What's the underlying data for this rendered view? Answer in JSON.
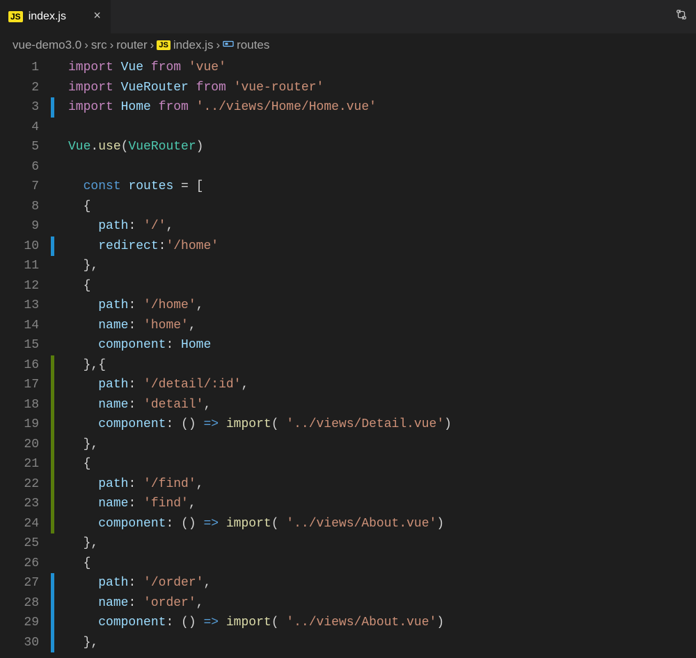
{
  "tab": {
    "filename": "index.js"
  },
  "breadcrumbs": {
    "parts": [
      "vue-demo3.0",
      "src",
      "router"
    ],
    "file": "index.js",
    "symbol": "routes"
  },
  "line_count": 30,
  "markers": [
    "none",
    "none",
    "mod",
    "none",
    "none",
    "none",
    "none",
    "none",
    "none",
    "mod",
    "none",
    "none",
    "none",
    "none",
    "none",
    "add",
    "add",
    "add",
    "add",
    "add",
    "add",
    "add",
    "add",
    "add",
    "none",
    "none",
    "mod",
    "mod",
    "mod",
    "mod"
  ],
  "code": [
    [
      [
        "kw",
        "import"
      ],
      [
        "punc",
        " "
      ],
      [
        "var",
        "Vue"
      ],
      [
        "punc",
        " "
      ],
      [
        "kw",
        "from"
      ],
      [
        "punc",
        " "
      ],
      [
        "str",
        "'vue'"
      ]
    ],
    [
      [
        "kw",
        "import"
      ],
      [
        "punc",
        " "
      ],
      [
        "var",
        "VueRouter"
      ],
      [
        "punc",
        " "
      ],
      [
        "kw",
        "from"
      ],
      [
        "punc",
        " "
      ],
      [
        "str",
        "'vue-router'"
      ]
    ],
    [
      [
        "kw",
        "import"
      ],
      [
        "punc",
        " "
      ],
      [
        "var",
        "Home"
      ],
      [
        "punc",
        " "
      ],
      [
        "kw",
        "from"
      ],
      [
        "punc",
        " "
      ],
      [
        "str",
        "'../views/Home/Home.vue'"
      ]
    ],
    [],
    [
      [
        "type",
        "Vue"
      ],
      [
        "punc",
        "."
      ],
      [
        "fn",
        "use"
      ],
      [
        "punc",
        "("
      ],
      [
        "type",
        "VueRouter"
      ],
      [
        "punc",
        ")"
      ]
    ],
    [],
    [
      [
        "punc",
        "  "
      ],
      [
        "const",
        "const"
      ],
      [
        "punc",
        " "
      ],
      [
        "var",
        "routes"
      ],
      [
        "punc",
        " = ["
      ]
    ],
    [
      [
        "punc",
        "  {"
      ]
    ],
    [
      [
        "punc",
        "    "
      ],
      [
        "var",
        "path"
      ],
      [
        "punc",
        ": "
      ],
      [
        "str",
        "'/'"
      ],
      [
        "punc",
        ","
      ]
    ],
    [
      [
        "punc",
        "    "
      ],
      [
        "var",
        "redirect"
      ],
      [
        "punc",
        ":"
      ],
      [
        "str",
        "'/home'"
      ]
    ],
    [
      [
        "punc",
        "  },"
      ]
    ],
    [
      [
        "punc",
        "  {"
      ]
    ],
    [
      [
        "punc",
        "    "
      ],
      [
        "var",
        "path"
      ],
      [
        "punc",
        ": "
      ],
      [
        "str",
        "'/home'"
      ],
      [
        "punc",
        ","
      ]
    ],
    [
      [
        "punc",
        "    "
      ],
      [
        "var",
        "name"
      ],
      [
        "punc",
        ": "
      ],
      [
        "str",
        "'home'"
      ],
      [
        "punc",
        ","
      ]
    ],
    [
      [
        "punc",
        "    "
      ],
      [
        "var",
        "component"
      ],
      [
        "punc",
        ": "
      ],
      [
        "var",
        "Home"
      ]
    ],
    [
      [
        "punc",
        "  },{"
      ]
    ],
    [
      [
        "punc",
        "    "
      ],
      [
        "var",
        "path"
      ],
      [
        "punc",
        ": "
      ],
      [
        "str",
        "'/detail/:id'"
      ],
      [
        "punc",
        ","
      ]
    ],
    [
      [
        "punc",
        "    "
      ],
      [
        "var",
        "name"
      ],
      [
        "punc",
        ": "
      ],
      [
        "str",
        "'detail'"
      ],
      [
        "punc",
        ","
      ]
    ],
    [
      [
        "punc",
        "    "
      ],
      [
        "var",
        "component"
      ],
      [
        "punc",
        ": () "
      ],
      [
        "const",
        "=>"
      ],
      [
        "punc",
        " "
      ],
      [
        "fn",
        "import"
      ],
      [
        "punc",
        "( "
      ],
      [
        "str",
        "'../views/Detail.vue'"
      ],
      [
        "punc",
        ")"
      ]
    ],
    [
      [
        "punc",
        "  },"
      ]
    ],
    [
      [
        "punc",
        "  {"
      ]
    ],
    [
      [
        "punc",
        "    "
      ],
      [
        "var",
        "path"
      ],
      [
        "punc",
        ": "
      ],
      [
        "str",
        "'/find'"
      ],
      [
        "punc",
        ","
      ]
    ],
    [
      [
        "punc",
        "    "
      ],
      [
        "var",
        "name"
      ],
      [
        "punc",
        ": "
      ],
      [
        "str",
        "'find'"
      ],
      [
        "punc",
        ","
      ]
    ],
    [
      [
        "punc",
        "    "
      ],
      [
        "var",
        "component"
      ],
      [
        "punc",
        ": () "
      ],
      [
        "const",
        "=>"
      ],
      [
        "punc",
        " "
      ],
      [
        "fn",
        "import"
      ],
      [
        "punc",
        "( "
      ],
      [
        "str",
        "'../views/About.vue'"
      ],
      [
        "punc",
        ")"
      ]
    ],
    [
      [
        "punc",
        "  },"
      ]
    ],
    [
      [
        "punc",
        "  {"
      ]
    ],
    [
      [
        "punc",
        "    "
      ],
      [
        "var",
        "path"
      ],
      [
        "punc",
        ": "
      ],
      [
        "str",
        "'/order'"
      ],
      [
        "punc",
        ","
      ]
    ],
    [
      [
        "punc",
        "    "
      ],
      [
        "var",
        "name"
      ],
      [
        "punc",
        ": "
      ],
      [
        "str",
        "'order'"
      ],
      [
        "punc",
        ","
      ]
    ],
    [
      [
        "punc",
        "    "
      ],
      [
        "var",
        "component"
      ],
      [
        "punc",
        ": () "
      ],
      [
        "const",
        "=>"
      ],
      [
        "punc",
        " "
      ],
      [
        "fn",
        "import"
      ],
      [
        "punc",
        "( "
      ],
      [
        "str",
        "'../views/About.vue'"
      ],
      [
        "punc",
        ")"
      ]
    ],
    [
      [
        "punc",
        "  },"
      ]
    ]
  ]
}
